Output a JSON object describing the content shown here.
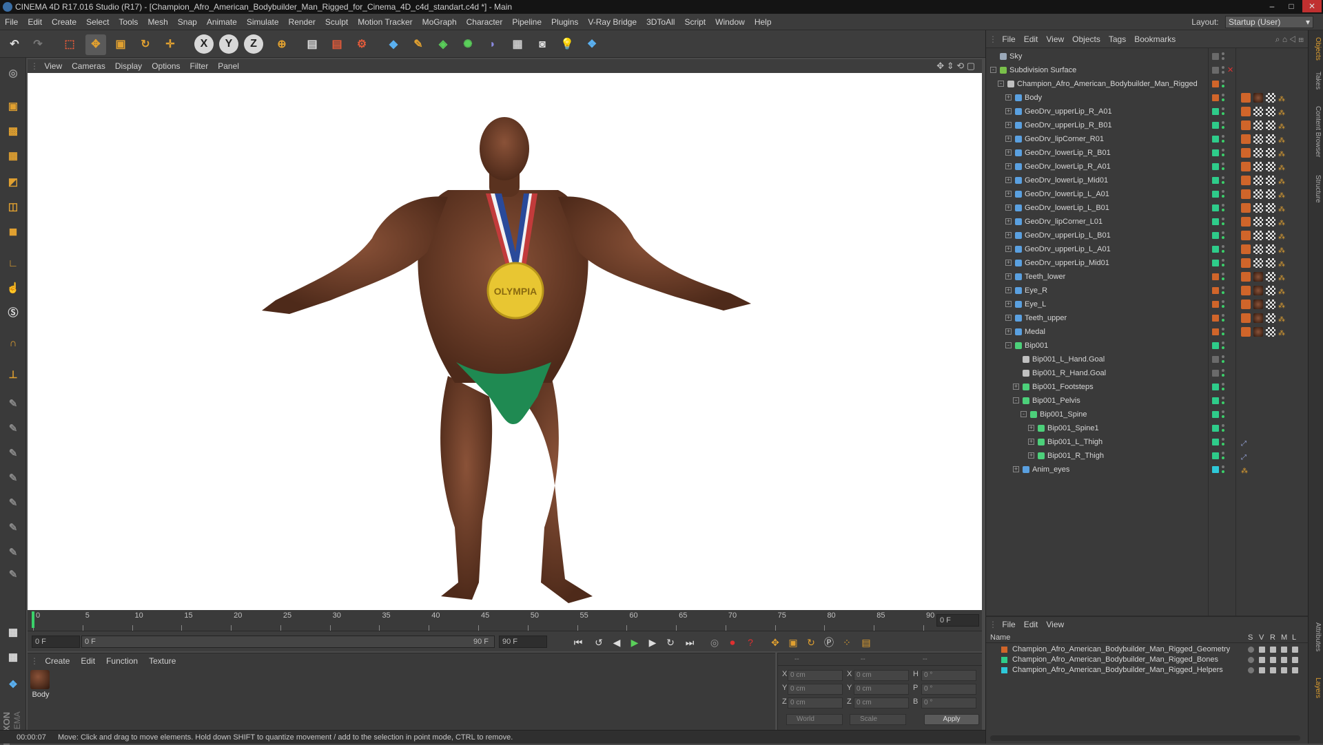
{
  "window": {
    "title": "CINEMA 4D R17.016 Studio (R17) - [Champion_Afro_American_Bodybuilder_Man_Rigged_for_Cinema_4D_c4d_standart.c4d *] - Main"
  },
  "menubar": [
    "File",
    "Edit",
    "Create",
    "Select",
    "Tools",
    "Mesh",
    "Snap",
    "Animate",
    "Simulate",
    "Render",
    "Sculpt",
    "Motion Tracker",
    "MoGraph",
    "Character",
    "Pipeline",
    "Plugins",
    "V-Ray Bridge",
    "3DToAll",
    "Script",
    "Window",
    "Help"
  ],
  "layout": {
    "label": "Layout:",
    "value": "Startup (User)"
  },
  "toolbar": {
    "axes": [
      "X",
      "Y",
      "Z"
    ]
  },
  "viewport": {
    "menu": [
      "View",
      "Cameras",
      "Display",
      "Options",
      "Filter",
      "Panel"
    ],
    "medal_text": "OLYMPIA"
  },
  "timeline": {
    "ticks": [
      "0",
      "5",
      "10",
      "15",
      "20",
      "25",
      "30",
      "35",
      "40",
      "45",
      "50",
      "55",
      "60",
      "65",
      "70",
      "75",
      "80",
      "85",
      "90"
    ],
    "frame_field": "0 F"
  },
  "transport": {
    "start": "0 F",
    "range_start": "0 F",
    "range_end": "90 F",
    "end": "90 F"
  },
  "materials": {
    "menu": [
      "Create",
      "Edit",
      "Function",
      "Texture"
    ],
    "items": [
      {
        "name": "Body"
      }
    ]
  },
  "coords": {
    "headers": [
      "--",
      "--",
      "--"
    ],
    "rows": [
      {
        "a": "X",
        "av": "0 cm",
        "b": "X",
        "bv": "0 cm",
        "c": "H",
        "cv": "0 °"
      },
      {
        "a": "Y",
        "av": "0 cm",
        "b": "Y",
        "bv": "0 cm",
        "c": "P",
        "cv": "0 °"
      },
      {
        "a": "Z",
        "av": "0 cm",
        "b": "Z",
        "bv": "0 cm",
        "c": "B",
        "cv": "0 °"
      }
    ],
    "world": "World",
    "scale": "Scale",
    "apply": "Apply"
  },
  "status": {
    "time": "00:00:07",
    "message": "Move: Click and drag to move elements. Hold down SHIFT to quantize movement / add to the selection in point mode, CTRL to remove."
  },
  "objects": {
    "menu": [
      "File",
      "Edit",
      "View",
      "Objects",
      "Tags",
      "Bookmarks"
    ],
    "rows": [
      {
        "name": "Sky",
        "indent": 0,
        "icon": "#9aa8b8",
        "layer": "",
        "exp": ""
      },
      {
        "name": "Subdivision Surface",
        "indent": 0,
        "icon": "#7ac04a",
        "layer": "",
        "exp": "-"
      },
      {
        "name": "Champion_Afro_American_Bodybuilder_Man_Rigged",
        "indent": 1,
        "icon": "#c0c0c0",
        "layer": "#d0652a",
        "exp": "-"
      },
      {
        "name": "Body",
        "indent": 2,
        "icon": "#5aa0e0",
        "layer": "#d0652a",
        "exp": "+"
      },
      {
        "name": "GeoDrv_upperLip_R_A01",
        "indent": 2,
        "icon": "#5aa0e0",
        "layer": "#2ecc8a",
        "exp": "+"
      },
      {
        "name": "GeoDrv_upperLip_R_B01",
        "indent": 2,
        "icon": "#5aa0e0",
        "layer": "#2ecc8a",
        "exp": "+"
      },
      {
        "name": "GeoDrv_lipCorner_R01",
        "indent": 2,
        "icon": "#5aa0e0",
        "layer": "#2ecc8a",
        "exp": "+"
      },
      {
        "name": "GeoDrv_lowerLip_R_B01",
        "indent": 2,
        "icon": "#5aa0e0",
        "layer": "#2ecc8a",
        "exp": "+"
      },
      {
        "name": "GeoDrv_lowerLip_R_A01",
        "indent": 2,
        "icon": "#5aa0e0",
        "layer": "#2ecc8a",
        "exp": "+"
      },
      {
        "name": "GeoDrv_lowerLip_Mid01",
        "indent": 2,
        "icon": "#5aa0e0",
        "layer": "#2ecc8a",
        "exp": "+"
      },
      {
        "name": "GeoDrv_lowerLip_L_A01",
        "indent": 2,
        "icon": "#5aa0e0",
        "layer": "#2ecc8a",
        "exp": "+"
      },
      {
        "name": "GeoDrv_lowerLip_L_B01",
        "indent": 2,
        "icon": "#5aa0e0",
        "layer": "#2ecc8a",
        "exp": "+"
      },
      {
        "name": "GeoDrv_lipCorner_L01",
        "indent": 2,
        "icon": "#5aa0e0",
        "layer": "#2ecc8a",
        "exp": "+"
      },
      {
        "name": "GeoDrv_upperLip_L_B01",
        "indent": 2,
        "icon": "#5aa0e0",
        "layer": "#2ecc8a",
        "exp": "+"
      },
      {
        "name": "GeoDrv_upperLip_L_A01",
        "indent": 2,
        "icon": "#5aa0e0",
        "layer": "#2ecc8a",
        "exp": "+"
      },
      {
        "name": "GeoDrv_upperLip_Mid01",
        "indent": 2,
        "icon": "#5aa0e0",
        "layer": "#2ecc8a",
        "exp": "+"
      },
      {
        "name": "Teeth_lower",
        "indent": 2,
        "icon": "#5aa0e0",
        "layer": "#d0652a",
        "exp": "+"
      },
      {
        "name": "Eye_R",
        "indent": 2,
        "icon": "#5aa0e0",
        "layer": "#d0652a",
        "exp": "+"
      },
      {
        "name": "Eye_L",
        "indent": 2,
        "icon": "#5aa0e0",
        "layer": "#d0652a",
        "exp": "+"
      },
      {
        "name": "Teeth_upper",
        "indent": 2,
        "icon": "#5aa0e0",
        "layer": "#d0652a",
        "exp": "+"
      },
      {
        "name": "Medal",
        "indent": 2,
        "icon": "#5aa0e0",
        "layer": "#d0652a",
        "exp": "+"
      },
      {
        "name": "Bip001",
        "indent": 2,
        "icon": "#4cd07a",
        "layer": "#2ecc8a",
        "exp": "-"
      },
      {
        "name": "Bip001_L_Hand.Goal",
        "indent": 3,
        "icon": "#c0c0c0",
        "layer": "",
        "exp": ""
      },
      {
        "name": "Bip001_R_Hand.Goal",
        "indent": 3,
        "icon": "#c0c0c0",
        "layer": "",
        "exp": ""
      },
      {
        "name": "Bip001_Footsteps",
        "indent": 3,
        "icon": "#4cd07a",
        "layer": "#2ecc8a",
        "exp": "+"
      },
      {
        "name": "Bip001_Pelvis",
        "indent": 3,
        "icon": "#4cd07a",
        "layer": "#2ecc8a",
        "exp": "-"
      },
      {
        "name": "Bip001_Spine",
        "indent": 4,
        "icon": "#4cd07a",
        "layer": "#2ecc8a",
        "exp": "-"
      },
      {
        "name": "Bip001_Spine1",
        "indent": 5,
        "icon": "#4cd07a",
        "layer": "#2ecc8a",
        "exp": "+"
      },
      {
        "name": "Bip001_L_Thigh",
        "indent": 5,
        "icon": "#4cd07a",
        "layer": "#2ecc8a",
        "exp": "+"
      },
      {
        "name": "Bip001_R_Thigh",
        "indent": 5,
        "icon": "#4cd07a",
        "layer": "#2ecc8a",
        "exp": "+"
      },
      {
        "name": "Anim_eyes",
        "indent": 3,
        "icon": "#5aa0e0",
        "layer": "#2ec8d8",
        "exp": "+"
      }
    ]
  },
  "layers": {
    "menu": [
      "File",
      "Edit",
      "View"
    ],
    "header": {
      "name": "Name",
      "cols": [
        "S",
        "V",
        "R",
        "M",
        "L"
      ]
    },
    "rows": [
      {
        "name": "Champion_Afro_American_Bodybuilder_Man_Rigged_Geometry",
        "color": "#d0652a"
      },
      {
        "name": "Champion_Afro_American_Bodybuilder_Man_Rigged_Bones",
        "color": "#2ecc8a"
      },
      {
        "name": "Champion_Afro_American_Bodybuilder_Man_Rigged_Helpers",
        "color": "#2ec8d8"
      }
    ]
  },
  "side_tabs": [
    "Objects",
    "Takes",
    "Content Browser",
    "Structure",
    "Attributes",
    "Layers"
  ]
}
